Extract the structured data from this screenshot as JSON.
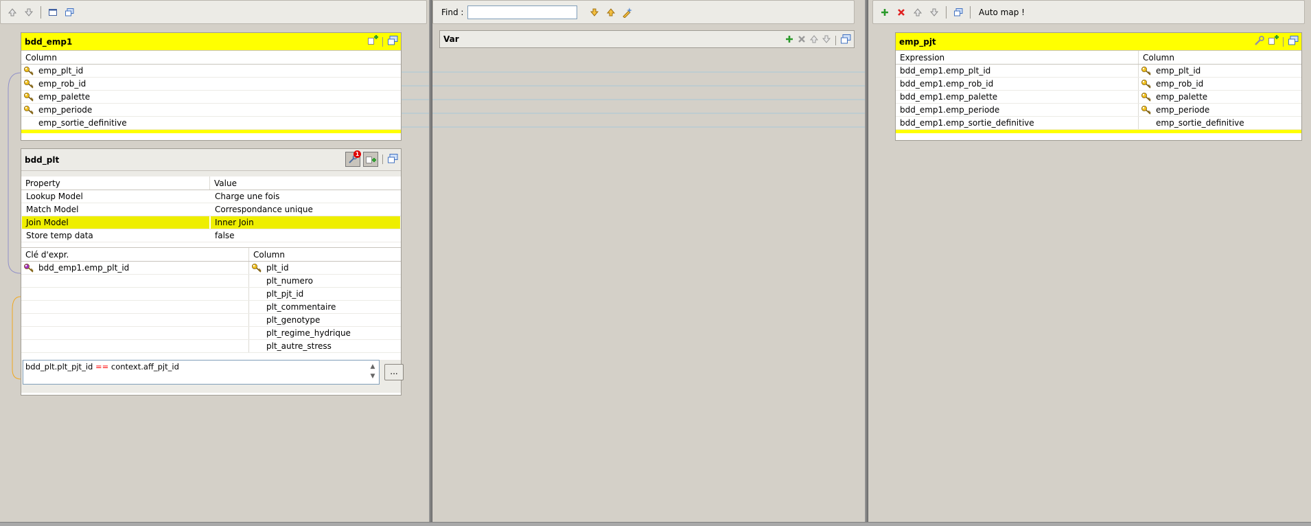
{
  "left_toolbar": {
    "buttons": [
      {
        "name": "move-up-icon"
      },
      {
        "name": "move-down-icon"
      },
      {
        "name": "minimize-icon"
      },
      {
        "name": "property-icon"
      }
    ]
  },
  "mid_toolbar": {
    "find_label": "Find :",
    "find_value": "",
    "buttons": [
      {
        "name": "find-next-icon"
      },
      {
        "name": "find-previous-icon"
      },
      {
        "name": "highlight-icon"
      }
    ]
  },
  "right_toolbar": {
    "auto_map_label": "Auto map !"
  },
  "bdd_emp1": {
    "title": "bdd_emp1",
    "header_column": "Column",
    "rows": [
      {
        "name": "emp_plt_id",
        "key": true
      },
      {
        "name": "emp_rob_id",
        "key": true
      },
      {
        "name": "emp_palette",
        "key": true
      },
      {
        "name": "emp_periode",
        "key": true
      },
      {
        "name": "emp_sortie_definitive",
        "key": false
      }
    ]
  },
  "bdd_plt": {
    "title": "bdd_plt",
    "badge_count": "1",
    "props_header": {
      "property": "Property",
      "value": "Value"
    },
    "props": [
      {
        "property": "Lookup Model",
        "value": "Charge une fois",
        "selected": false
      },
      {
        "property": "Match Model",
        "value": "Correspondance unique",
        "selected": false
      },
      {
        "property": "Join Model",
        "value": "Inner Join",
        "selected": true
      },
      {
        "property": "Store temp data",
        "value": "false",
        "selected": false
      }
    ],
    "cols_header": {
      "expr_key": "Clé d'expr.",
      "column": "Column"
    },
    "rows": [
      {
        "expr": "bdd_emp1.emp_plt_id",
        "column": "plt_id",
        "key": true
      },
      {
        "expr": "",
        "column": "plt_numero",
        "key": false
      },
      {
        "expr": "",
        "column": "plt_pjt_id",
        "key": false
      },
      {
        "expr": "",
        "column": "plt_commentaire",
        "key": false
      },
      {
        "expr": "",
        "column": "plt_genotype",
        "key": false
      },
      {
        "expr": "",
        "column": "plt_regime_hydrique",
        "key": false
      },
      {
        "expr": "",
        "column": "plt_autre_stress",
        "key": false
      }
    ],
    "filter": {
      "left": "bdd_plt.plt_pjt_id ",
      "op": "==",
      "right": " context.aff_pjt_id"
    },
    "ellipsis_label": "..."
  },
  "var_table": {
    "title": "Var"
  },
  "emp_pjt": {
    "title": "emp_pjt",
    "header_expression": "Expression",
    "header_column": "Column",
    "rows": [
      {
        "expr": "bdd_emp1.emp_plt_id",
        "column": "emp_plt_id",
        "key": true
      },
      {
        "expr": "bdd_emp1.emp_rob_id",
        "column": "emp_rob_id",
        "key": true
      },
      {
        "expr": "bdd_emp1.emp_palette",
        "column": "emp_palette",
        "key": true
      },
      {
        "expr": "bdd_emp1.emp_periode",
        "column": "emp_periode",
        "key": true
      },
      {
        "expr": "bdd_emp1.emp_sortie_definitive",
        "column": "emp_sortie_definitive",
        "key": false
      }
    ]
  },
  "colors": {
    "panel_bg": "#d4d0c8",
    "title_yellow": "#ffff00",
    "selected_row": "#eeee00",
    "key_icon_yellow": "#f0c020",
    "key_icon_purple": "#a030c0",
    "link_line": "#a8c8d8"
  }
}
